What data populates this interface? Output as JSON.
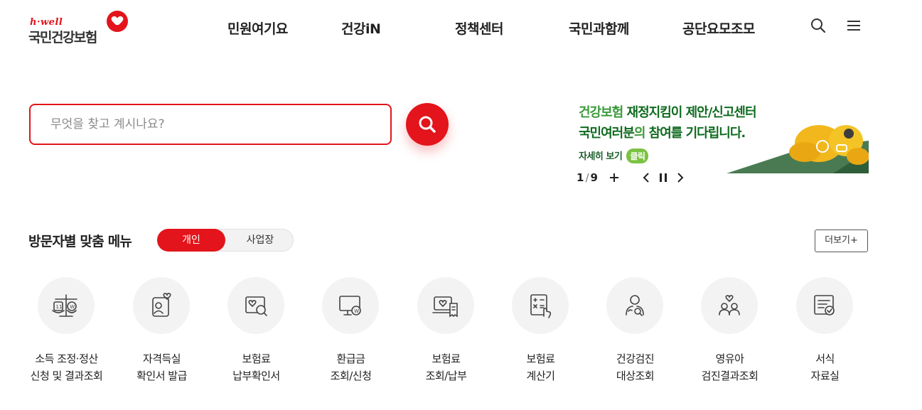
{
  "header": {
    "logo": {
      "small": "h·well",
      "main": "국민건강보험"
    },
    "nav": [
      "민원여기요",
      "건강iN",
      "정책센터",
      "국민과함께",
      "공단요모조모"
    ],
    "icons": {
      "search": "search-icon",
      "menu": "hamburger-menu-icon"
    }
  },
  "search": {
    "placeholder": "무엇을 찾고 계시나요?",
    "value": "",
    "button_icon": "search-icon"
  },
  "banner": {
    "line1_a": "건강보험 ",
    "line1_b": "재정지킴이 제안/신고센터",
    "line2_a": "국민여러분",
    "line2_b": "의 ",
    "line2_c": "참여를 기다립니다.",
    "more": "자세히 보기",
    "click": "클릭",
    "pager_current": "1",
    "pager_total": "9",
    "controls": [
      "plus-icon",
      "chevron-left-icon",
      "pause-icon",
      "chevron-right-icon"
    ]
  },
  "visitor_menu": {
    "title": "방문자별 맞춤 메뉴",
    "toggle": [
      "개인",
      "사업장"
    ],
    "selected": "개인",
    "more": "더보기+",
    "items": [
      {
        "line1": "소득 조정·정산",
        "line2": "신청 및 결과조회",
        "icon": "scale-balance-icon"
      },
      {
        "line1": "자격득실",
        "line2": "확인서 발급",
        "icon": "id-card-heart-icon"
      },
      {
        "line1": "보험료",
        "line2": "납부확인서",
        "icon": "document-search-icon"
      },
      {
        "line1": "환급금",
        "line2": "조회/신청",
        "icon": "monitor-won-icon"
      },
      {
        "line1": "보험료",
        "line2": "조회/납부",
        "icon": "laptop-receipt-icon"
      },
      {
        "line1": "보험료",
        "line2": "계산기",
        "icon": "calculator-icon"
      },
      {
        "line1": "건강검진",
        "line2": "대상조회",
        "icon": "person-search-icon"
      },
      {
        "line1": "영유아",
        "line2": "검진결과조회",
        "icon": "family-heart-icon"
      },
      {
        "line1": "서식",
        "line2": "자료실",
        "icon": "form-document-icon"
      }
    ]
  },
  "colors": {
    "brand": "#e3141b",
    "banner_green": "#3a9a3a",
    "banner_dark_green": "#0f6b1f"
  }
}
